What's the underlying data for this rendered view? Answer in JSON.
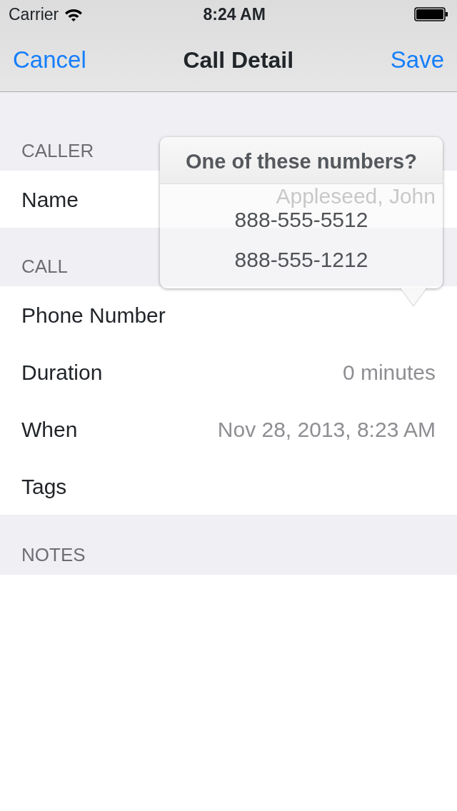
{
  "status_bar": {
    "carrier": "Carrier",
    "time": "8:24 AM"
  },
  "nav": {
    "left": "Cancel",
    "title": "Call Detail",
    "right": "Save"
  },
  "sections": [
    {
      "header": "CALLER",
      "rows": [
        {
          "label": "Name",
          "value": "Appleseed, John"
        }
      ]
    },
    {
      "header": "CALL",
      "rows": [
        {
          "label": "Phone Number"
        },
        {
          "label": "Duration",
          "value": "0  minutes"
        },
        {
          "label": "When",
          "value": "Nov 28, 2013, 8:23 AM"
        },
        {
          "label": "Tags"
        }
      ]
    },
    {
      "header": "NOTES"
    }
  ],
  "popover": {
    "title": "One of these numbers?",
    "options": [
      "888-555-5512",
      "888-555-1212"
    ]
  }
}
